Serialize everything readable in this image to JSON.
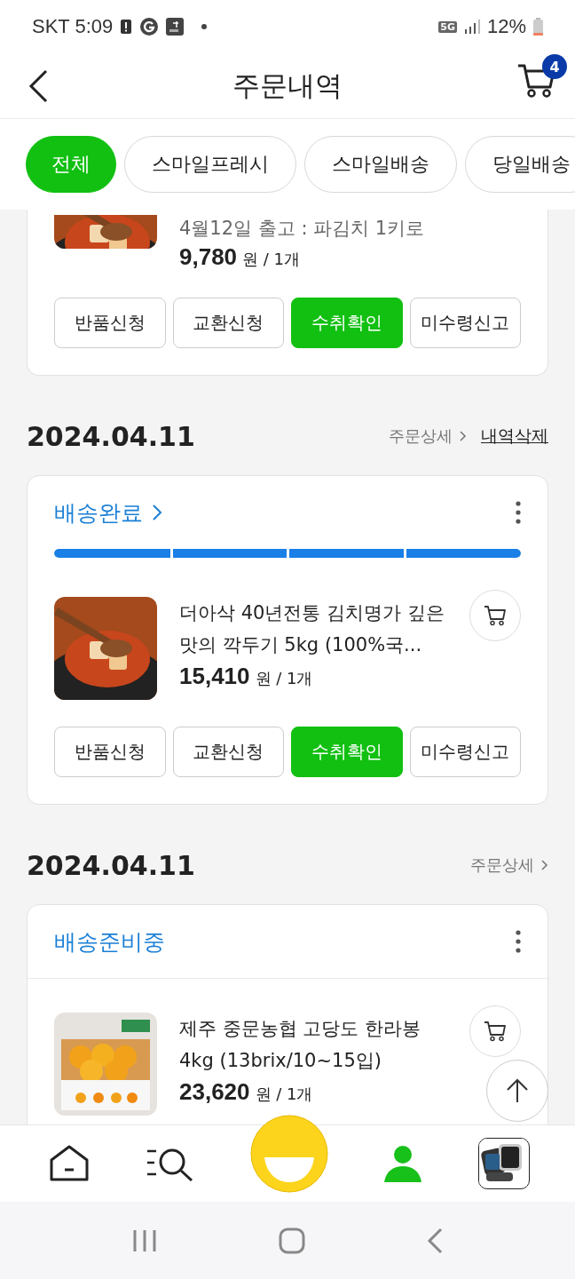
{
  "status_bar": {
    "carrier_time": "SKT 5:09",
    "network": "5G",
    "battery": "12%"
  },
  "header": {
    "title": "주문내역",
    "cart_count": "4"
  },
  "filters": [
    {
      "label": "전체",
      "selected": true
    },
    {
      "label": "스마일프레시",
      "selected": false
    },
    {
      "label": "스마일배송",
      "selected": false
    },
    {
      "label": "당일배송",
      "selected": false
    }
  ],
  "orders": [
    {
      "products": [
        {
          "option": "4월12일 출고 : 파김치 1키로",
          "price": "9,780",
          "unit": "원 / 1개",
          "cart_button": false
        }
      ],
      "actions": [
        {
          "label": "반품신청",
          "primary": false
        },
        {
          "label": "교환신청",
          "primary": false
        },
        {
          "label": "수취확인",
          "primary": true
        },
        {
          "label": "미수령신고",
          "primary": false
        }
      ]
    },
    {
      "date": "2024.04.11",
      "links": [
        {
          "label": "주문상세",
          "kind": "detail"
        },
        {
          "label": "내역삭제",
          "kind": "delete"
        }
      ],
      "status": {
        "label": "배송완료",
        "link": true
      },
      "progress": {
        "level": 1
      },
      "products": [
        {
          "title": "더아삭 40년전통 김치명가 깊은맛의 깍두기 5kg (100%국...",
          "price": "15,410",
          "unit": "원 / 1개",
          "cart_button": true
        }
      ],
      "actions": [
        {
          "label": "반품신청",
          "primary": false
        },
        {
          "label": "교환신청",
          "primary": false
        },
        {
          "label": "수취확인",
          "primary": true
        },
        {
          "label": "미수령신고",
          "primary": false
        }
      ]
    },
    {
      "date": "2024.04.11",
      "links": [
        {
          "label": "주문상세",
          "kind": "detail"
        }
      ],
      "status": {
        "label": "배송준비중",
        "link": false
      },
      "products": [
        {
          "title": "제주 중문농협 고당도 한라봉 4kg (13brix/10~15입)",
          "price": "23,620",
          "unit": "원 / 1개",
          "cart_button": true
        }
      ]
    }
  ],
  "bottom_nav": [
    {
      "kind": "home",
      "selected": false
    },
    {
      "kind": "category",
      "selected": false
    },
    {
      "kind": "smile",
      "selected": false
    },
    {
      "kind": "my",
      "selected": true
    },
    {
      "kind": "recent",
      "selected": false
    }
  ]
}
